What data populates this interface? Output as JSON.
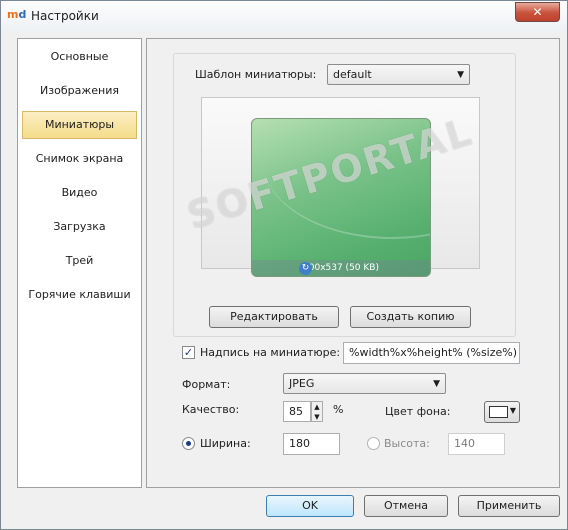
{
  "window": {
    "title": "Настройки",
    "close_glyph": "✕",
    "icon_letters": [
      "m",
      "d"
    ]
  },
  "sidebar": {
    "items": [
      {
        "label": "Основные"
      },
      {
        "label": "Изображения"
      },
      {
        "label": "Миниатюры",
        "active": true
      },
      {
        "label": "Снимок экрана"
      },
      {
        "label": "Видео"
      },
      {
        "label": "Загрузка"
      },
      {
        "label": "Трей"
      },
      {
        "label": "Горячие клавиши"
      }
    ]
  },
  "thumbnails": {
    "template_label": "Шаблон миниатюры:",
    "template_value": "default",
    "preview_caption": "800x537 (50 KB)",
    "watermark": "SOFTPORTAL",
    "edit_button": "Редактировать",
    "copy_button": "Создать копию",
    "caption_checkbox_label": "Надпись на миниатюре:",
    "caption_checked": true,
    "caption_value": "%width%x%height% (%size%)",
    "format_label": "Формат:",
    "format_value": "JPEG",
    "quality_label": "Качество:",
    "quality_value": "85",
    "quality_unit": "%",
    "bg_color_label": "Цвет фона:",
    "bg_color": "#ffffff",
    "width_label": "Ширина:",
    "width_value": "180",
    "width_selected": true,
    "height_label": "Высота:",
    "height_value": "140",
    "height_selected": false
  },
  "footer": {
    "ok": "OK",
    "cancel": "Отмена",
    "apply": "Применить"
  },
  "colors": {
    "active_nav": "#f4dc8a",
    "close_red": "#c8523b",
    "thumb_green": "#58b070"
  },
  "icons": {
    "close": "close-icon",
    "refresh": "refresh-icon",
    "dropdown": "chevron-down-icon"
  }
}
